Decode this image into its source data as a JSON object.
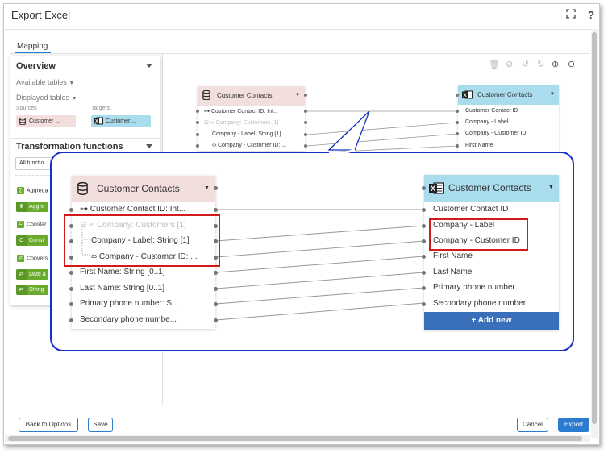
{
  "window": {
    "title": "Export Excel",
    "expand_icon": "expand-icon",
    "help_label": "?"
  },
  "tabs": [
    {
      "label": "Mapping"
    }
  ],
  "left_panel": {
    "overview_title": "Overview",
    "available_tables": "Available tables",
    "displayed_tables": "Displayed tables",
    "sources_label": "Sources",
    "targets_label": "Targets",
    "source_chip": "Customer ...",
    "target_chip": "Customer ...",
    "transformation_title": "Transformation functions",
    "filter_value": "All functio",
    "groups": [
      {
        "badge": "",
        "label": "Aggrega"
      },
      {
        "badge": "C",
        "label": "Constar"
      },
      {
        "badge": "",
        "label": "Convers"
      }
    ],
    "functions": [
      {
        "label": "Aggre"
      },
      {
        "label": "Const"
      },
      {
        "label": "Date a"
      },
      {
        "label": "String"
      }
    ]
  },
  "toolbar_icons": [
    "trash-icon",
    "link-icon",
    "undo-icon",
    "redo-icon",
    "zoom-in-icon",
    "zoom-out-icon"
  ],
  "mini_source": {
    "title": "Customer Contacts",
    "rows": [
      {
        "label": "Customer Contact ID: Int..."
      },
      {
        "label": "Company: Customers [1]"
      },
      {
        "label": "Company - Label: String [1]"
      },
      {
        "label": "Company - Customer ID: ..."
      }
    ]
  },
  "mini_target": {
    "title": "Customer Contacts",
    "rows": [
      {
        "label": "Customer Contact ID"
      },
      {
        "label": "Company - Label"
      },
      {
        "label": "Company - Customer ID"
      },
      {
        "label": "First Name"
      }
    ]
  },
  "zoom_source": {
    "title": "Customer Contacts",
    "rows": [
      {
        "label": "Customer Contact ID: Int..."
      },
      {
        "label": "Company: Customers [1]"
      },
      {
        "label": "Company - Label: String [1]"
      },
      {
        "label": "Company - Customer ID: ..."
      },
      {
        "label": "First Name: String [0..1]"
      },
      {
        "label": "Last Name: String [0..1]"
      },
      {
        "label": "Primary phone number: S..."
      },
      {
        "label": "Secondary phone numbe..."
      }
    ]
  },
  "zoom_target": {
    "title": "Customer Contacts",
    "rows": [
      {
        "label": "Customer Contact ID"
      },
      {
        "label": "Company - Label"
      },
      {
        "label": "Company - Customer ID"
      },
      {
        "label": "First Name"
      },
      {
        "label": "Last Name"
      },
      {
        "label": "Primary phone number"
      },
      {
        "label": "Secondary phone number"
      }
    ],
    "add_new": "+ Add new"
  },
  "footer": {
    "back": "Back to Options",
    "save": "Save",
    "cancel": "Cancel",
    "export": "Export"
  },
  "colors": {
    "accent": "#2b7bd0",
    "source_header": "#f3dede",
    "target_header": "#a9dcec",
    "highlight": "#d21a1a",
    "callout_border": "#1430c8",
    "function_green": "#6aaa2c"
  }
}
